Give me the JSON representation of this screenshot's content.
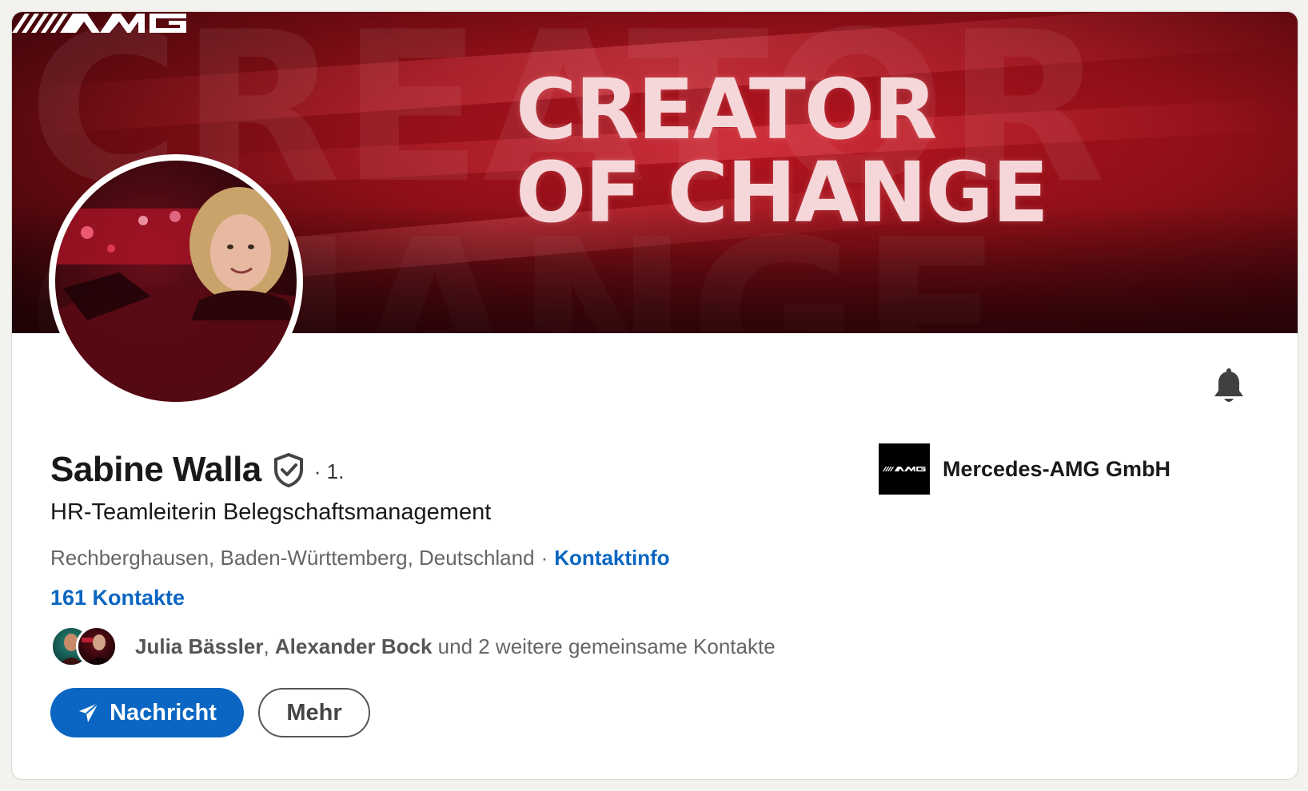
{
  "banner": {
    "headline_line1": "CREATOR",
    "headline_line2": "OF CHANGE",
    "logo_alt": "AMG",
    "colors": {
      "primary": "#9b111c",
      "dark": "#2a0306",
      "text": "#f6d7d9"
    }
  },
  "profile": {
    "name": "Sabine Walla",
    "degree": "· 1.",
    "headline": "HR-Teamleiterin Belegschaftsmanagement",
    "location": "Rechberghausen, Baden-Württemberg, Deutschland",
    "location_separator": "·",
    "contact_info_label": "Kontaktinfo",
    "contacts_label": "161 Kontakte"
  },
  "mutual": {
    "name1": "Julia Bässler",
    "separator": ", ",
    "name2": "Alexander Bock",
    "suffix": " und 2 weitere gemeinsame Kontakte"
  },
  "actions": {
    "message_label": "Nachricht",
    "more_label": "Mehr"
  },
  "company": {
    "name": "Mercedes-AMG GmbH",
    "logo_text": "AMG"
  },
  "icons": {
    "verified": "verified-shield-icon",
    "bell": "bell-icon",
    "send": "paper-plane-icon"
  },
  "colors": {
    "accent": "#0a66c2",
    "text": "#191919",
    "muted": "#666666"
  }
}
